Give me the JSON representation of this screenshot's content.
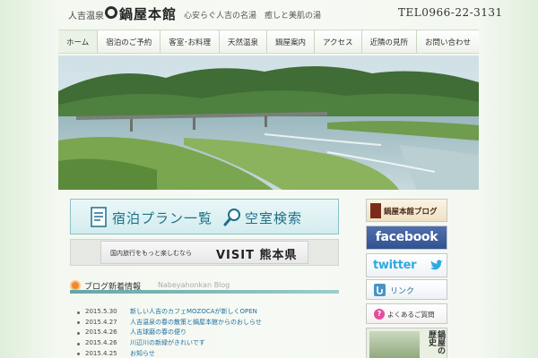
{
  "header": {
    "onsen": "人吉温泉",
    "logo": "鍋屋本館",
    "tagline": "心安らぐ人吉の名湯　癒しと美肌の湯",
    "tel": "TEL0966-22-3131"
  },
  "nav": {
    "items": [
      "ホーム",
      "宿泊のご予約",
      "客室･お料理",
      "天然温泉",
      "鍋屋案内",
      "アクセス",
      "近隣の見所",
      "お問い合わせ"
    ]
  },
  "hero": {
    "icon": "river-landscape-photo"
  },
  "booking": {
    "plan_label": "宿泊プラン一覧",
    "search_label": "空室検索"
  },
  "visit_banner": {
    "subtitle": "国内旅行をもっと楽しむなら",
    "title": "VISIT 熊本県"
  },
  "blog": {
    "title": "ブログ新着情報",
    "subtitle_en": "Nabeyahonkan Blog",
    "posts": [
      {
        "date": "2015.5.30",
        "title": "新しい人吉のカフェMOZOCAが新しくOPEN"
      },
      {
        "date": "2015.4.27",
        "title": "人吉温泉の春の散策と鍋屋本館からのおしらせ"
      },
      {
        "date": "2015.4.26",
        "title": "人吉球磨の春の便り"
      },
      {
        "date": "2015.4.26",
        "title": "川辺川の新緑がきれいです"
      },
      {
        "date": "2015.4.25",
        "title": "お知らせ"
      }
    ]
  },
  "sidebar": {
    "blog_banner": "鍋屋本館ブログ",
    "facebook": "facebook",
    "twitter": "twitter",
    "link": "リンク",
    "faq": "よくあるご質問",
    "history": "鍋屋の歴史"
  },
  "colors": {
    "nav_border": "#c8d6c0",
    "booking_text": "#1e6f89",
    "facebook_blue": "#3b5998",
    "twitter_blue": "#2da9e1",
    "news_link": "#1f6fa0"
  }
}
